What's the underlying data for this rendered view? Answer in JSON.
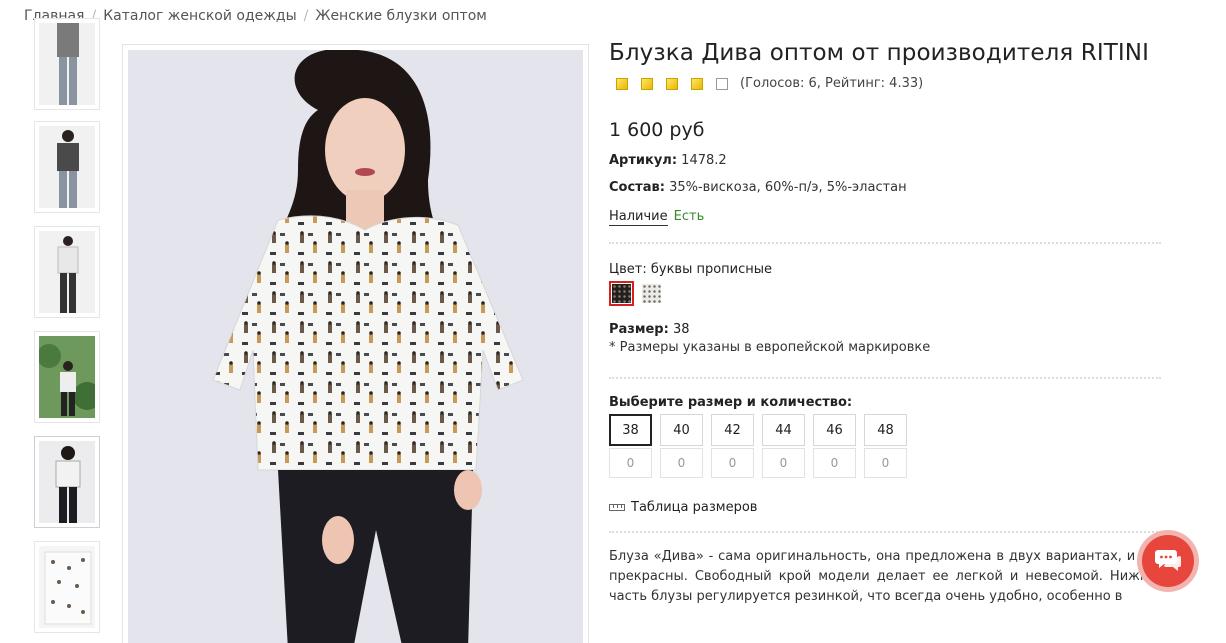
{
  "breadcrumb": [
    "Главная",
    "Каталог женской одежды",
    "Женские блузки оптом"
  ],
  "product": {
    "title": "Блузка Дива оптом от производителя RITINI",
    "rating": {
      "stars_filled": 4,
      "stars_total": 5,
      "votes_text": "(Голосов: 6, Рейтинг: 4.33)"
    },
    "price": "1 600 руб",
    "article_label": "Артикул:",
    "article_value": "1478.2",
    "composition_label": "Состав:",
    "composition_value": "35%-вискоза, 60%-п/э, 5%-эластан",
    "availability_label": "Наличие",
    "availability_value": "Есть",
    "color_label": "Цвет:",
    "color_value": "буквы прописные",
    "size_label": "Размер:",
    "size_value": "38",
    "size_note": "* Размеры указаны в европейской маркировке",
    "pick_label": "Выберите размер и количество:",
    "sizes": [
      "38",
      "40",
      "42",
      "44",
      "46",
      "48"
    ],
    "quantities": [
      "0",
      "0",
      "0",
      "0",
      "0",
      "0"
    ],
    "selected_size": "38",
    "size_table_label": "Таблица размеров",
    "description": "Блуза «Дива» - сама оригинальность, она предложена в двух вариантах, и обе прекрасны. Свободный крой модели делает ее легкой и невесомой. Нижняя часть блузы регулируется резинкой, что всегда очень удобно, особенно в"
  },
  "colors": {
    "accent": "#d32020",
    "available": "#3a8a2a",
    "chat": "#e8453c"
  },
  "icons": {
    "chat": "chat-bubble-icon",
    "ruler": "ruler-icon",
    "star": "star-icon"
  }
}
